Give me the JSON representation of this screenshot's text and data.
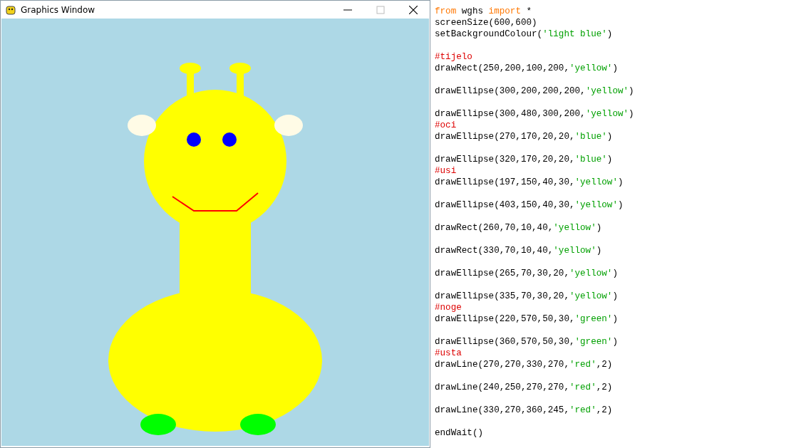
{
  "window": {
    "title": "Graphics Window"
  },
  "code": {
    "lines": [
      {
        "kind": "code",
        "segments": [
          {
            "kind": "keyword",
            "text": "from"
          },
          {
            "kind": "plain",
            "text": " wghs "
          },
          {
            "kind": "keyword",
            "text": "import"
          },
          {
            "kind": "plain",
            "text": " *"
          }
        ]
      },
      {
        "kind": "code",
        "segments": [
          {
            "kind": "plain",
            "text": "screenSize(600,600)"
          }
        ]
      },
      {
        "kind": "code",
        "segments": [
          {
            "kind": "plain",
            "text": "setBackgroundColour("
          },
          {
            "kind": "string",
            "text": "'light blue'"
          },
          {
            "kind": "plain",
            "text": ")"
          }
        ]
      },
      {
        "kind": "blank"
      },
      {
        "kind": "code",
        "segments": [
          {
            "kind": "comment",
            "text": "#tijelo"
          }
        ]
      },
      {
        "kind": "code",
        "segments": [
          {
            "kind": "plain",
            "text": "drawRect(250,200,100,200,"
          },
          {
            "kind": "string",
            "text": "'yellow'"
          },
          {
            "kind": "plain",
            "text": ")"
          }
        ]
      },
      {
        "kind": "blank"
      },
      {
        "kind": "code",
        "segments": [
          {
            "kind": "plain",
            "text": "drawEllipse(300,200,200,200,"
          },
          {
            "kind": "string",
            "text": "'yellow'"
          },
          {
            "kind": "plain",
            "text": ")"
          }
        ]
      },
      {
        "kind": "blank"
      },
      {
        "kind": "code",
        "segments": [
          {
            "kind": "plain",
            "text": "drawEllipse(300,480,300,200,"
          },
          {
            "kind": "string",
            "text": "'yellow'"
          },
          {
            "kind": "plain",
            "text": ")"
          }
        ]
      },
      {
        "kind": "code",
        "segments": [
          {
            "kind": "comment",
            "text": "#oci"
          }
        ]
      },
      {
        "kind": "code",
        "segments": [
          {
            "kind": "plain",
            "text": "drawEllipse(270,170,20,20,"
          },
          {
            "kind": "string",
            "text": "'blue'"
          },
          {
            "kind": "plain",
            "text": ")"
          }
        ]
      },
      {
        "kind": "blank"
      },
      {
        "kind": "code",
        "segments": [
          {
            "kind": "plain",
            "text": "drawEllipse(320,170,20,20,"
          },
          {
            "kind": "string",
            "text": "'blue'"
          },
          {
            "kind": "plain",
            "text": ")"
          }
        ]
      },
      {
        "kind": "code",
        "segments": [
          {
            "kind": "comment",
            "text": "#usi"
          }
        ]
      },
      {
        "kind": "code",
        "segments": [
          {
            "kind": "plain",
            "text": "drawEllipse(197,150,40,30,"
          },
          {
            "kind": "string",
            "text": "'yellow'"
          },
          {
            "kind": "plain",
            "text": ")"
          }
        ]
      },
      {
        "kind": "blank"
      },
      {
        "kind": "code",
        "segments": [
          {
            "kind": "plain",
            "text": "drawEllipse(403,150,40,30,"
          },
          {
            "kind": "string",
            "text": "'yellow'"
          },
          {
            "kind": "plain",
            "text": ")"
          }
        ]
      },
      {
        "kind": "blank"
      },
      {
        "kind": "code",
        "segments": [
          {
            "kind": "plain",
            "text": "drawRect(260,70,10,40,"
          },
          {
            "kind": "string",
            "text": "'yellow'"
          },
          {
            "kind": "plain",
            "text": ")"
          }
        ]
      },
      {
        "kind": "blank"
      },
      {
        "kind": "code",
        "segments": [
          {
            "kind": "plain",
            "text": "drawRect(330,70,10,40,"
          },
          {
            "kind": "string",
            "text": "'yellow'"
          },
          {
            "kind": "plain",
            "text": ")"
          }
        ]
      },
      {
        "kind": "blank"
      },
      {
        "kind": "code",
        "segments": [
          {
            "kind": "plain",
            "text": "drawEllipse(265,70,30,20,"
          },
          {
            "kind": "string",
            "text": "'yellow'"
          },
          {
            "kind": "plain",
            "text": ")"
          }
        ]
      },
      {
        "kind": "blank"
      },
      {
        "kind": "code",
        "segments": [
          {
            "kind": "plain",
            "text": "drawEllipse(335,70,30,20,"
          },
          {
            "kind": "string",
            "text": "'yellow'"
          },
          {
            "kind": "plain",
            "text": ")"
          }
        ]
      },
      {
        "kind": "code",
        "segments": [
          {
            "kind": "comment",
            "text": "#noge"
          }
        ]
      },
      {
        "kind": "code",
        "segments": [
          {
            "kind": "plain",
            "text": "drawEllipse(220,570,50,30,"
          },
          {
            "kind": "string",
            "text": "'green'"
          },
          {
            "kind": "plain",
            "text": ")"
          }
        ]
      },
      {
        "kind": "blank"
      },
      {
        "kind": "code",
        "segments": [
          {
            "kind": "plain",
            "text": "drawEllipse(360,570,50,30,"
          },
          {
            "kind": "string",
            "text": "'green'"
          },
          {
            "kind": "plain",
            "text": ")"
          }
        ]
      },
      {
        "kind": "code",
        "segments": [
          {
            "kind": "comment",
            "text": "#usta"
          }
        ]
      },
      {
        "kind": "code",
        "segments": [
          {
            "kind": "plain",
            "text": "drawLine(270,270,330,270,"
          },
          {
            "kind": "string",
            "text": "'red'"
          },
          {
            "kind": "plain",
            "text": ",2)"
          }
        ]
      },
      {
        "kind": "blank"
      },
      {
        "kind": "code",
        "segments": [
          {
            "kind": "plain",
            "text": "drawLine(240,250,270,270,"
          },
          {
            "kind": "string",
            "text": "'red'"
          },
          {
            "kind": "plain",
            "text": ",2)"
          }
        ]
      },
      {
        "kind": "blank"
      },
      {
        "kind": "code",
        "segments": [
          {
            "kind": "plain",
            "text": "drawLine(330,270,360,245,"
          },
          {
            "kind": "string",
            "text": "'red'"
          },
          {
            "kind": "plain",
            "text": ",2)"
          }
        ]
      },
      {
        "kind": "blank"
      },
      {
        "kind": "code",
        "segments": [
          {
            "kind": "plain",
            "text": "endWait()"
          }
        ]
      }
    ]
  }
}
